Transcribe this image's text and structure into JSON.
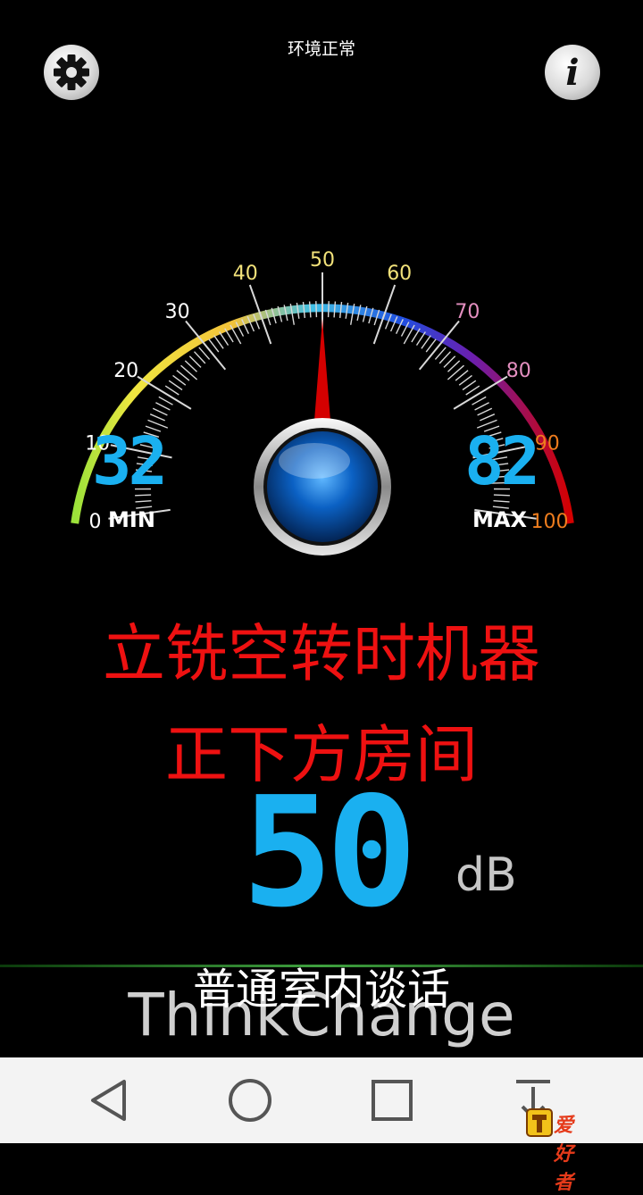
{
  "status": {
    "text": "环境正常"
  },
  "toolbar": {
    "settings_icon": "gear-icon",
    "info_icon": "info-icon",
    "info_glyph": "i"
  },
  "gauge": {
    "scale_min": 0,
    "scale_max": 100,
    "needle_value": 50,
    "tick_labels": [
      "0",
      "10",
      "20",
      "30",
      "40",
      "50",
      "60",
      "70",
      "80",
      "90",
      "100"
    ],
    "tick_label_colors": [
      "#ffffff",
      "#ffffff",
      "#ffffff",
      "#ffffff",
      "#f2e27a",
      "#f2e27a",
      "#f2e27a",
      "#e48fc0",
      "#e48fc0",
      "#ee7d1e",
      "#ee7d1e"
    ],
    "min_label": "MIN",
    "max_label": "MAX",
    "min_value": "32",
    "max_value": "82",
    "accent_color": "#1ab0f0",
    "needle_color": "#d40000"
  },
  "location": {
    "line1": "立铣空转时机器",
    "line2": "正下方房间"
  },
  "reading": {
    "value": "50",
    "unit": "dB",
    "description": "普通室内谈话"
  },
  "brand": {
    "name": "ThinkChange"
  },
  "navbar": {
    "back_icon": "back-triangle-icon",
    "home_icon": "home-circle-icon",
    "recent_icon": "recent-square-icon",
    "down_icon": "download-arrow-icon"
  },
  "watermark": {
    "text": "爱好者"
  }
}
